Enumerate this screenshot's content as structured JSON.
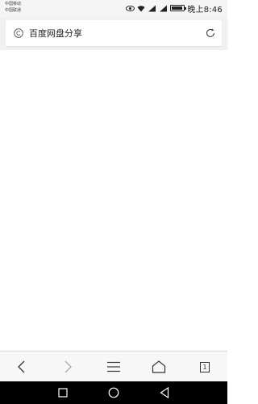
{
  "status_bar": {
    "carrier_line1": "中国移动",
    "carrier_line2": "中国联通",
    "time": "晚上8:46",
    "icons": [
      "eye-icon",
      "wifi-icon",
      "signal-icon",
      "signal-icon",
      "battery-icon"
    ]
  },
  "url_bar": {
    "title": "百度网盘分享",
    "site_icon": "copyright-c-icon",
    "action_icon": "reload-icon"
  },
  "toolbar": {
    "tab_count": "1",
    "buttons": [
      "back-icon",
      "forward-icon",
      "menu-icon",
      "home-icon",
      "tabs-icon"
    ]
  },
  "nav_bar": {
    "buttons": [
      "recent-apps-icon",
      "home-circle-icon",
      "back-triangle-icon"
    ]
  },
  "colors": {
    "status_bg": "#f5f5f5",
    "url_bar_bg": "#f1f1f1",
    "toolbar_bg": "#f7f7f7",
    "nav_bar_bg": "#000000"
  }
}
